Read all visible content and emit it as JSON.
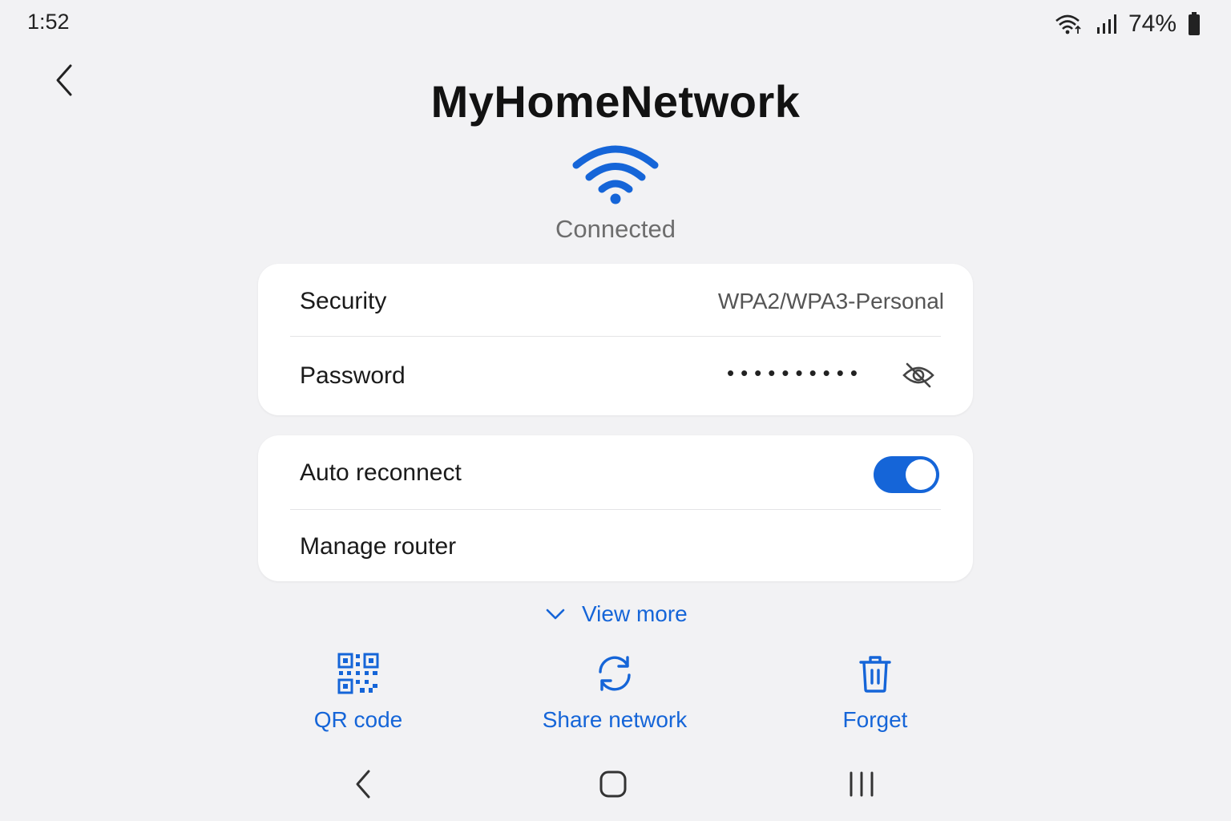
{
  "status_bar": {
    "time": "1:52",
    "battery": "74%"
  },
  "header": {
    "network_name": "MyHomeNetwork",
    "status": "Connected"
  },
  "details": {
    "security_label": "Security",
    "security_value": "WPA2/WPA3-Personal",
    "password_label": "Password",
    "password_masked": "••••••••••"
  },
  "settings": {
    "auto_reconnect_label": "Auto reconnect",
    "auto_reconnect_on": true,
    "manage_router_label": "Manage router"
  },
  "view_more": "View more",
  "actions": [
    {
      "label": "QR code",
      "icon": "qr-code-icon"
    },
    {
      "label": "Share network",
      "icon": "refresh-icon"
    },
    {
      "label": "Forget",
      "icon": "trash-icon"
    }
  ],
  "colors": {
    "accent": "#1565d8",
    "background": "#f2f2f4",
    "card": "#ffffff"
  }
}
